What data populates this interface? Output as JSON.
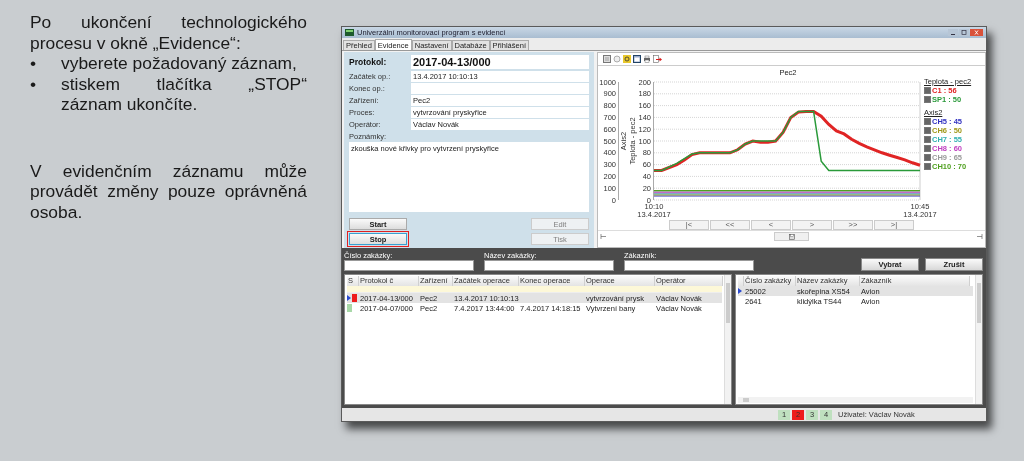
{
  "instructions": {
    "intro": "Po ukončení technologického procesu v okně „Evidence“:",
    "bullets": [
      {
        "marker": "•",
        "text": "vyberete požadovaný záznam,"
      },
      {
        "marker": "•",
        "text": "stiskem tlačítka „STOP“ záznam ukončíte."
      }
    ],
    "note": "V evidenčním záznamu může provádět změny pouze oprávněná osoba."
  },
  "window": {
    "title": "Univerzální monitorovací program s evidencí",
    "tabs": [
      {
        "label": "Přehled",
        "selected": false
      },
      {
        "label": "Evidence",
        "selected": true
      },
      {
        "label": "Nastavení",
        "selected": false
      },
      {
        "label": "Databáze",
        "selected": false
      },
      {
        "label": "Přihlášení",
        "selected": false
      }
    ],
    "form": {
      "protocol": {
        "label": "Protokol:",
        "value": "2017-04-13/000"
      },
      "fields": [
        {
          "label": "Začátek op.:",
          "value": "13.4.2017 10:10:13"
        },
        {
          "label": "Konec op.:"
        },
        {
          "label": "Zařízení:",
          "value": "Pec2"
        },
        {
          "label": "Proces:",
          "value": "vytvrzování pryskyřice"
        },
        {
          "label": "Operátor:",
          "value": "Václav Novák"
        }
      ],
      "notes": {
        "label": "Poznámky:",
        "value": "zkouška nové křivky pro vytvrzení pryskyřice"
      },
      "buttons": [
        {
          "label": "Start",
          "disabled": false,
          "highlighted": false
        },
        {
          "label": "Edit",
          "disabled": true,
          "highlighted": false
        },
        {
          "label": "Stop",
          "disabled": false,
          "highlighted": true
        },
        {
          "label": "Tisk",
          "disabled": true,
          "highlighted": false
        }
      ]
    },
    "chart": {
      "chart_data": {
        "type": "line",
        "title": "Pec2",
        "ylabel": "Teplota - pec2",
        "categories": [
          "10:10 13.4.2017",
          null,
          null,
          null,
          null,
          null,
          null,
          null,
          null,
          null,
          null,
          null,
          null,
          null,
          null,
          null,
          null,
          null,
          null,
          null,
          null,
          null,
          null,
          null,
          null,
          null,
          null,
          null,
          null,
          null,
          null,
          null,
          null,
          null,
          null,
          "10:45 13.4.2017"
        ],
        "ylim": [
          0,
          200
        ],
        "grid": true,
        "yticks": [
          0,
          20,
          40,
          60,
          80,
          100,
          120,
          140,
          160,
          180,
          200
        ],
        "series": [
          {
            "name": "C1",
            "color": "#e02424",
            "values": [
              50,
              50,
              55,
              60,
              68,
              77,
              80,
              80,
              80,
              80,
              80,
              85,
              95,
              100,
              98,
              98,
              100,
              115,
              140,
              149,
              150,
              150,
              142,
              128,
              117,
              112,
              103,
              96,
              90,
              85,
              80,
              76,
              72,
              68,
              63,
              59
            ]
          },
          {
            "name": "SP1",
            "color": "#2a9a3a",
            "values": [
              50,
              50,
              56,
              62,
              70,
              78,
              80,
              80,
              80,
              80,
              80,
              85,
              95,
              100,
              100,
              100,
              100,
              115,
              140,
              150,
              150,
              150,
              66,
              50,
              50,
              50,
              50,
              50,
              50,
              50,
              50,
              50,
              50,
              50,
              50,
              50
            ]
          }
        ]
      },
      "secondary_axis": {
        "label": "Axis2",
        "ticks": [
          "1000",
          "900",
          "800",
          "700",
          "600",
          "500",
          "400",
          "300",
          "200",
          "100",
          "0"
        ]
      },
      "legend": [
        {
          "title": "Teplota - pec2",
          "items": [
            {
              "reading": ": 56",
              "checked": true
            },
            {
              "reading": ": 50",
              "checked": true
            }
          ]
        },
        {
          "title": "Axis2",
          "items": [
            {
              "name": "CH5",
              "reading": ": 45",
              "color": "#3030c0",
              "checked": true
            },
            {
              "name": "CH6",
              "reading": ": 50",
              "color": "#a09818",
              "checked": true
            },
            {
              "name": "CH7",
              "reading": ": 55",
              "color": "#30b0b0",
              "checked": true
            },
            {
              "name": "CH8",
              "reading": ": 60",
              "color": "#c040c0",
              "checked": true
            },
            {
              "name": "CH9",
              "reading": ": 65",
              "color": "#9a9a9a",
              "checked": true
            },
            {
              "name": "CH10",
              "reading": ": 70",
              "color": "#50a020",
              "checked": true
            }
          ]
        }
      ],
      "nav_buttons": [
        "|<",
        "<<",
        "<",
        ">",
        ">>",
        ">|"
      ]
    },
    "filters": [
      {
        "label": "Číslo zakázky:"
      },
      {
        "label": "Název zakázky:"
      },
      {
        "label": "Zákazník:"
      }
    ],
    "filter_buttons": [
      "Vybrat",
      "Zrušit"
    ],
    "protocols": {
      "columns": [
        "S",
        "Protokol č",
        "Zařízení",
        "Začátek operace",
        "Konec operace",
        "Operace",
        "Operátor"
      ],
      "rows": [
        {
          "selected": true,
          "color": "#ee1c1c",
          "cells": [
            "",
            "2017-04-13/000",
            "Pec2",
            "13.4.2017 10:10:13",
            "",
            "vytvrzování prysk",
            "Václav Novák"
          ]
        },
        {
          "selected": false,
          "color": "#a8d8a8",
          "cells": [
            "",
            "2017-04-07/000",
            "Pec2",
            "7.4.2017 13:44:00",
            "7.4.2017 14:18:15",
            "Vytvrzení bany",
            "Václav Novák"
          ]
        }
      ]
    },
    "orders": {
      "columns": [
        "Číslo zakázky",
        "Název zakázky",
        "Zákazník"
      ],
      "rows": [
        {
          "selected": true,
          "cells": [
            "25002",
            "skořepina XS54",
            "Avion"
          ]
        },
        {
          "selected": false,
          "cells": [
            "2641",
            "klidýlka TS44",
            "Avion"
          ]
        }
      ]
    },
    "status_bar": {
      "pages": [
        {
          "label": "1",
          "selected": false
        },
        {
          "label": "2",
          "selected": true
        },
        {
          "label": "3",
          "selected": false
        },
        {
          "label": "4",
          "selected": false
        }
      ],
      "user": "Uživatel: Václav Novák"
    }
  }
}
